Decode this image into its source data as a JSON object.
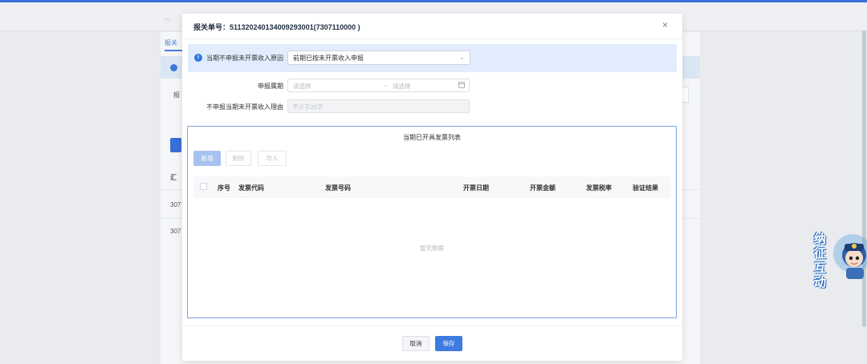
{
  "modal": {
    "title": "报关单号：511320240134009293001(7307110000 )",
    "close_symbol": "×",
    "reason_label": "当期不申报未开票收入原因",
    "reason_value": "前期已按未开票收入申报",
    "period_label": "申报属期",
    "period_start_placeholder": "请选择",
    "period_separator": "-",
    "period_end_placeholder": "请选择",
    "reason_text_label": "不申报当期未开票收入理由",
    "reason_text_placeholder": "不少于20字",
    "table": {
      "title": "当期已开具发票列表",
      "buttons": {
        "add": "新增",
        "delete": "删除",
        "import": "导入"
      },
      "columns": [
        "序号",
        "发票代码",
        "发票号码",
        "开票日期",
        "开票金额",
        "发票税率",
        "验证结果"
      ],
      "empty_text": "暂无数据"
    },
    "footer": {
      "cancel": "取消",
      "save": "保存"
    }
  },
  "background": {
    "tab_label": "报关",
    "row_label_1": "报",
    "section_label": "汇",
    "row_1": "307",
    "row_2": "307",
    "mascot_text": "纳 征 互 动"
  },
  "colors": {
    "primary": "#3d7be0",
    "info_bg": "#e1edfc",
    "table_border": "#7aa3d6"
  }
}
